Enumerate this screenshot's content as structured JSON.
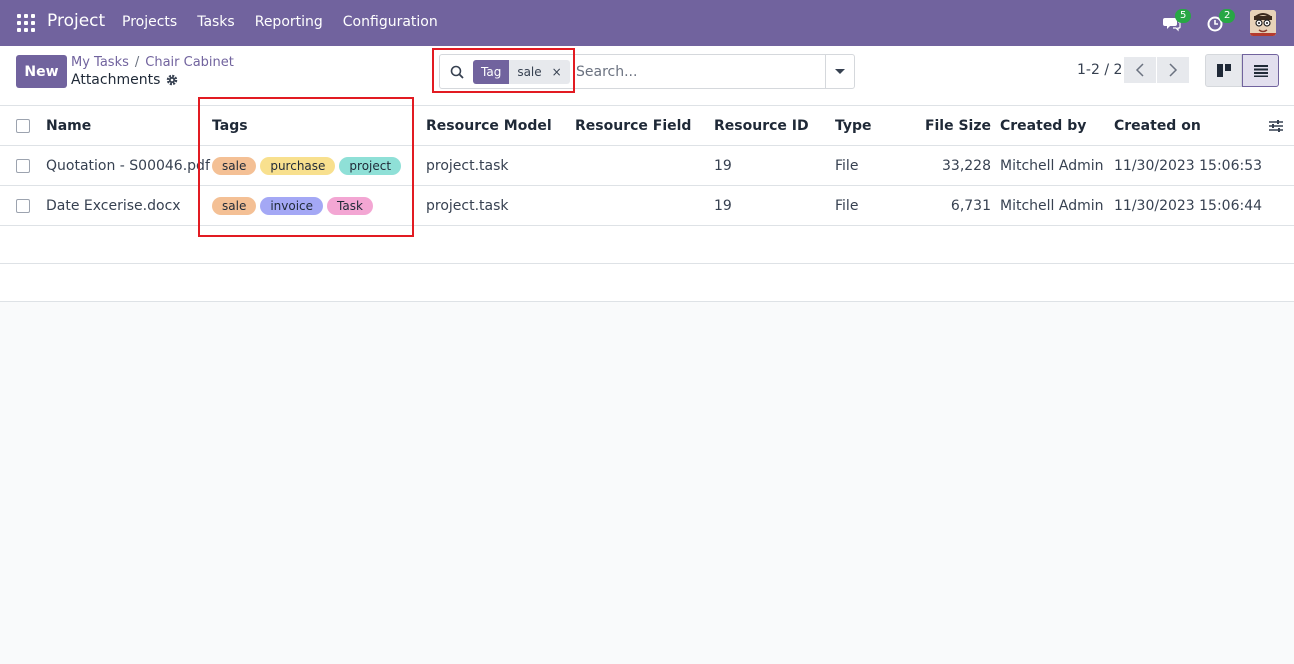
{
  "navbar": {
    "brand": "Project",
    "menu": [
      "Projects",
      "Tasks",
      "Reporting",
      "Configuration"
    ],
    "messages_count": "5",
    "activities_count": "2"
  },
  "control": {
    "new_label": "New",
    "breadcrumb": [
      "My Tasks",
      "Chair Cabinet"
    ],
    "breadcrumb_separator": "/",
    "title": "Attachments",
    "search": {
      "facet_label": "Tag",
      "facet_value": "sale",
      "facet_close": "×",
      "placeholder": "Search..."
    },
    "pager": "1-2 / 2"
  },
  "list": {
    "columns": [
      "Name",
      "Tags",
      "Resource Model",
      "Resource Field",
      "Resource ID",
      "Type",
      "File Size",
      "Created by",
      "Created on"
    ],
    "rows": [
      {
        "name": "Quotation - S00046.pdf",
        "tags": [
          {
            "label": "sale",
            "color": "#f4c095"
          },
          {
            "label": "purchase",
            "color": "#f8e08e"
          },
          {
            "label": "project",
            "color": "#8fe0d7"
          }
        ],
        "resource_model": "project.task",
        "resource_field": "",
        "resource_id": "19",
        "type": "File",
        "file_size": "33,228",
        "created_by": "Mitchell Admin",
        "created_on": "11/30/2023 15:06:53"
      },
      {
        "name": "Date Excerise.docx",
        "tags": [
          {
            "label": "sale",
            "color": "#f4c095"
          },
          {
            "label": "invoice",
            "color": "#a4a8f5"
          },
          {
            "label": "Task",
            "color": "#f3a6d3"
          }
        ],
        "resource_model": "project.task",
        "resource_field": "",
        "resource_id": "19",
        "type": "File",
        "file_size": "6,731",
        "created_by": "Mitchell Admin",
        "created_on": "11/30/2023 15:06:44"
      }
    ]
  },
  "colors": {
    "brand": "#71639e",
    "highlight": "#e21b22",
    "badge": "#28a745"
  }
}
